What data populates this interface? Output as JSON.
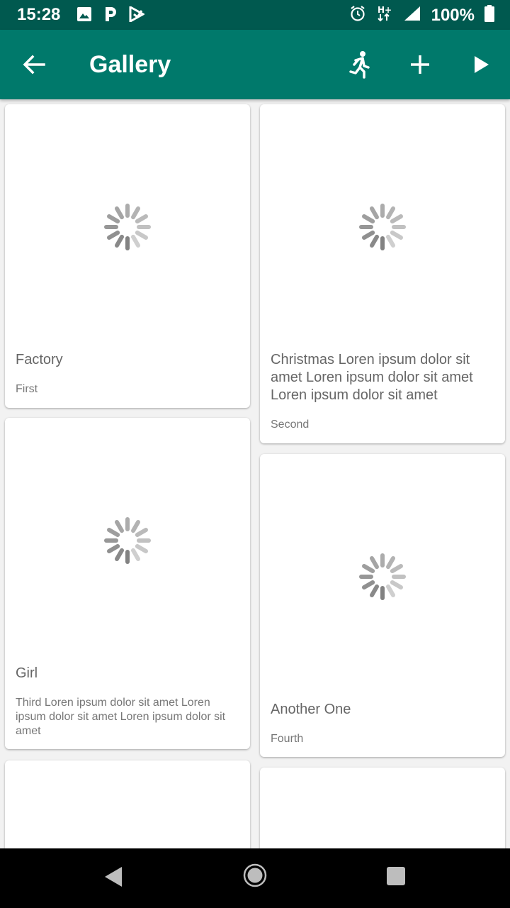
{
  "status_bar": {
    "time": "15:28",
    "battery": "100%",
    "left_icons": [
      "image-icon",
      "parking-icon",
      "play-store-icon"
    ],
    "right_icons": [
      "alarm-icon",
      "network-hplus-icon",
      "signal-icon",
      "battery-icon"
    ]
  },
  "app_bar": {
    "title": "Gallery",
    "actions": [
      "run-icon",
      "add-icon",
      "play-icon"
    ]
  },
  "cards": [
    {
      "title": "Factory",
      "subtitle": "First"
    },
    {
      "title": "Christmas Loren ipsum dolor sit amet Loren ipsum dolor sit amet Loren ipsum dolor sit amet",
      "subtitle": "Second"
    },
    {
      "title": "Girl",
      "subtitle": "Third Loren ipsum dolor sit amet Loren ipsum dolor sit amet Loren ipsum dolor sit amet"
    },
    {
      "title": "Another One",
      "subtitle": "Fourth"
    },
    {
      "title": "",
      "subtitle": ""
    },
    {
      "title": "",
      "subtitle": ""
    }
  ],
  "colors": {
    "status_bar": "#00594f",
    "app_bar": "#00796b",
    "background": "#f2f2f2",
    "card": "#ffffff"
  },
  "nav_bar": {
    "buttons": [
      "back-triangle-icon",
      "home-circle-icon",
      "recents-square-icon"
    ]
  }
}
